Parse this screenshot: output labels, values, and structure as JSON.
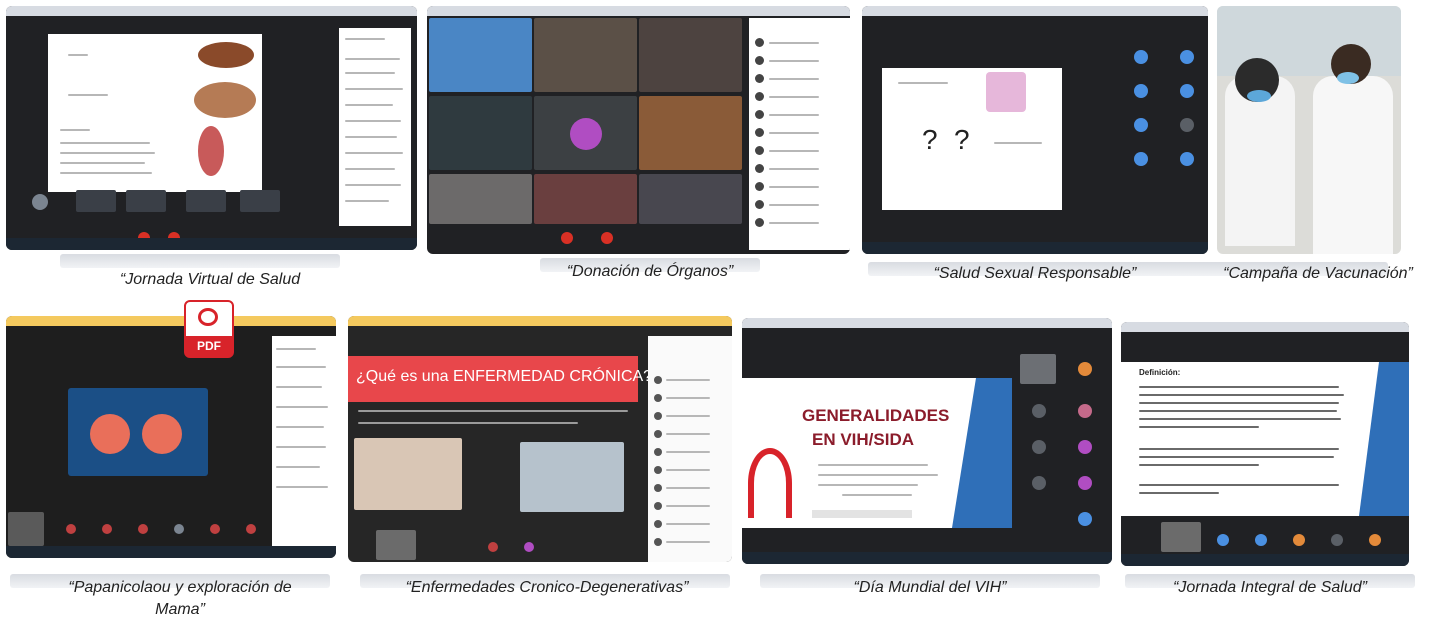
{
  "captions": [
    "“Jornada Virtual de Salud",
    "“Donación de Órganos”",
    "“Salud Sexual Responsable”",
    "“Campaña de Vacunación”",
    "“Papanicolaou y exploración de",
    "Mama”",
    "“Enfermedades Cronico-Degenerativas”",
    "“Día Mundial del VIH”",
    "“Jornada Integral de Salud”"
  ],
  "slide_texts": {
    "cronica_title": "¿Qué es una ENFERMEDAD CRÓNICA?",
    "vih_title_1": "GENERALIDADES",
    "vih_title_2": "EN VIH/SIDA",
    "jornada_integral_heading": "Definición:",
    "pdf_label": "PDF"
  },
  "colors": {
    "meet_dark": "#202124",
    "end_call_red": "#d93025",
    "cronica_red": "#e8474b",
    "vih_blue": "#2f6fb8",
    "vih_title": "#8b1c2b",
    "pdf_red": "#d8232a"
  }
}
